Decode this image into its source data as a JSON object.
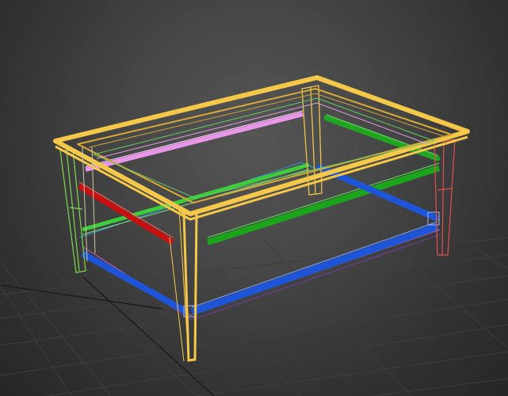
{
  "viewport": {
    "view_mode": "perspective",
    "display_mode": "wireframe",
    "background": "#474747",
    "grid_color": "#3c3c3c",
    "grid_major_color": "#1e1e1e"
  },
  "scene": {
    "object": "coffee table",
    "parts": [
      {
        "name": "tabletop-frame",
        "color": "#f0c44c"
      },
      {
        "name": "front-left-leg",
        "color": "#f0c44c"
      },
      {
        "name": "back-left-leg",
        "color": "#8ee05a"
      },
      {
        "name": "back-right-leg",
        "color": "#e05555"
      },
      {
        "name": "rear-middle-leg",
        "color": "#f0c44c"
      },
      {
        "name": "pink-rail",
        "color": "#e08ee0"
      },
      {
        "name": "red-rail",
        "color": "#d41414"
      },
      {
        "name": "green-rails",
        "color": "#22bb22"
      },
      {
        "name": "blue-shelf-frame",
        "color": "#2255dd"
      }
    ]
  }
}
